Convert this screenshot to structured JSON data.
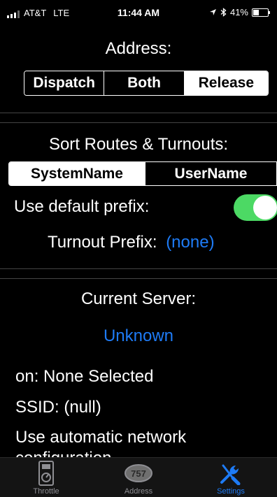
{
  "status_bar": {
    "carrier": "AT&T",
    "network": "LTE",
    "time": "11:44 AM",
    "battery_percent": "41%",
    "battery_level": 0.41
  },
  "address": {
    "title": "Address:",
    "options": [
      "Dispatch",
      "Both",
      "Release"
    ],
    "selected": "Release"
  },
  "sort": {
    "title": "Sort Routes & Turnouts:",
    "options": [
      "SystemName",
      "UserName"
    ],
    "selected": "SystemName"
  },
  "prefix": {
    "use_default_label": "Use default prefix:",
    "use_default_enabled": true,
    "turnout_prefix_label": "Turnout Prefix:",
    "turnout_prefix_value": "(none)"
  },
  "server": {
    "title": "Current Server:",
    "name": "Unknown",
    "on_line": "on: None Selected",
    "ssid_line": "SSID: (null)",
    "auto_network_line": "Use automatic network",
    "auto_network_cont": "configuration"
  },
  "tab_bar": {
    "throttle_label": "Throttle",
    "address_label": "Address",
    "address_badge": "757",
    "settings_label": "Settings",
    "active_tab": "Settings"
  },
  "colors": {
    "accent": "#1e7bf5",
    "toggle_on": "#4cd964",
    "background": "#000000"
  }
}
